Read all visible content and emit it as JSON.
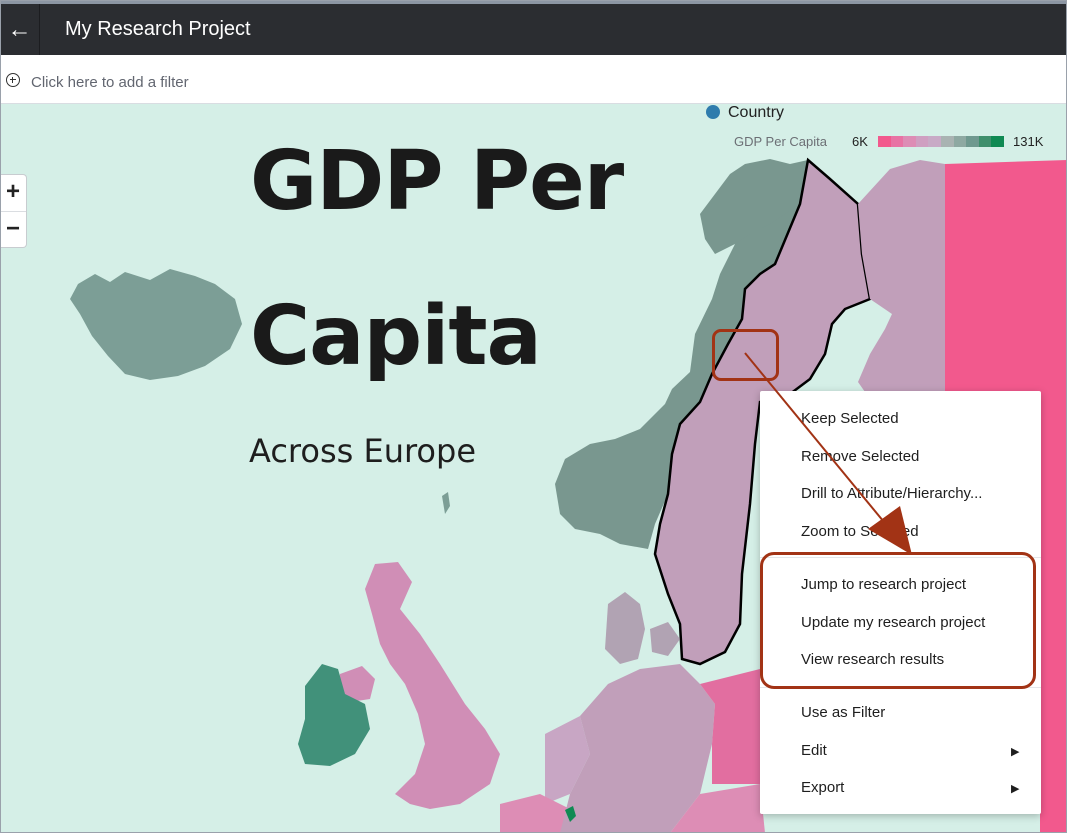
{
  "header": {
    "back_icon": "back-arrow-icon",
    "title": "My Research Project"
  },
  "filter_bar": {
    "icon": "plus-circle-icon",
    "placeholder": "Click here to add a filter"
  },
  "zoom": {
    "in_label": "+",
    "out_label": "−"
  },
  "map_text": {
    "title_line1": "GDP Per",
    "title_line2": "Capita",
    "subtitle": "Across Europe"
  },
  "legend": {
    "country_label": "Country",
    "measure_label": "GDP Per Capita",
    "min_label": "6K",
    "max_label": "131K",
    "scale_colors": [
      "#f2598d",
      "#e873a4",
      "#dd8db5",
      "#cf9fc1",
      "#c8aac6",
      "#a9b3b2",
      "#8ea9a2",
      "#6f998f",
      "#3f8f6c",
      "#0f8a53"
    ]
  },
  "colors": {
    "accent_callout": "#a23315",
    "sea": "#d5efe7",
    "header_bg": "#2b2d31"
  },
  "context_menu": {
    "items": [
      {
        "label": "Keep Selected"
      },
      {
        "label": "Remove Selected"
      },
      {
        "label": "Drill to Attribute/Hierarchy..."
      },
      {
        "label": "Zoom to Selected"
      },
      {
        "label": "Jump to research project"
      },
      {
        "label": "Update my research project"
      },
      {
        "label": "View research results"
      },
      {
        "label": "Use as Filter"
      },
      {
        "label": "Edit",
        "submenu": true
      },
      {
        "label": "Export",
        "submenu": true
      }
    ]
  }
}
